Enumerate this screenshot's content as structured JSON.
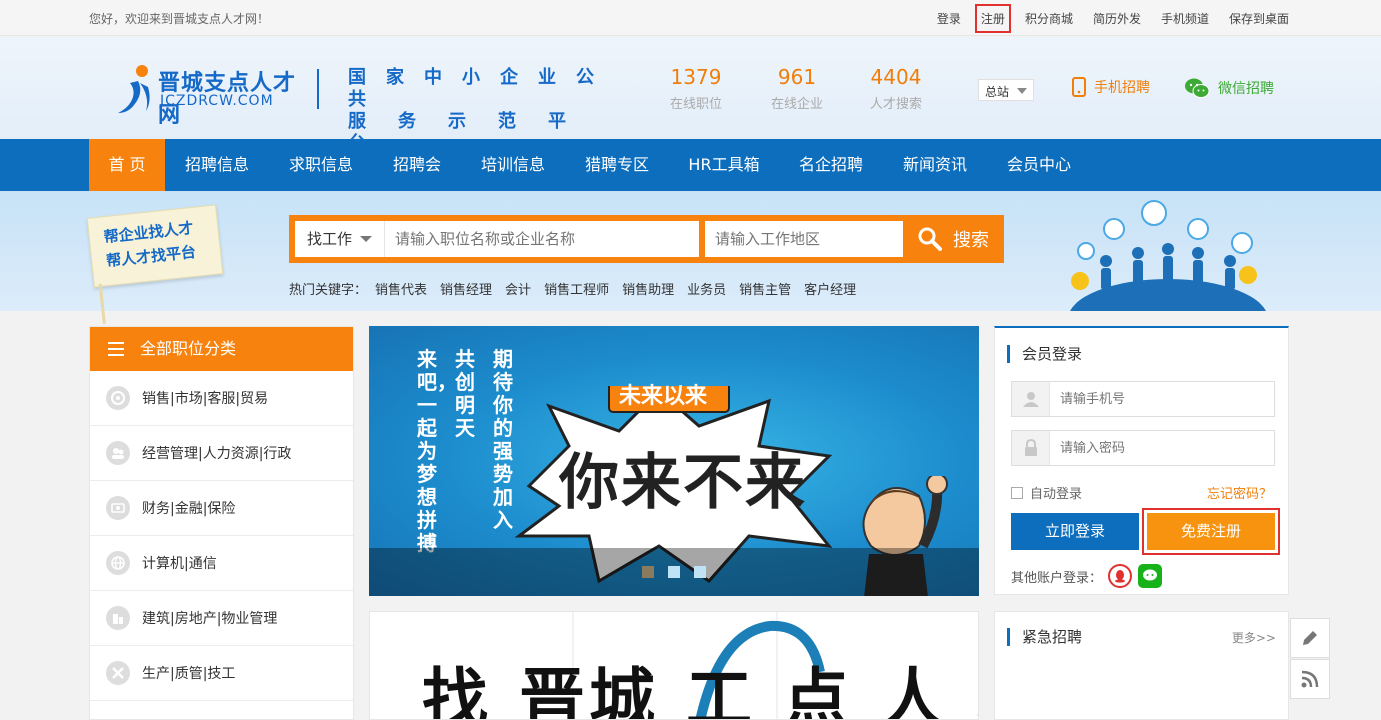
{
  "topbar": {
    "welcome": "您好，欢迎来到晋城支点人才网！",
    "links": [
      "登录",
      "注册",
      "积分商城",
      "简历外发",
      "手机频道",
      "保存到桌面"
    ]
  },
  "header": {
    "logo_name": "晋城支点人才网",
    "logo_domain": "JCZDRCW.COM",
    "slogan_line1": "国家中小企业公共",
    "slogan_line2": "服务示范平台",
    "stats": [
      {
        "num": "1379",
        "label": "在线职位"
      },
      {
        "num": "961",
        "label": "在线企业"
      },
      {
        "num": "4404",
        "label": "人才搜索"
      }
    ],
    "station": "总站",
    "mobile_recruit": "手机招聘",
    "wechat_recruit": "微信招聘",
    "colors": {
      "primary": "#0d6ebd",
      "accent": "#f7820e",
      "wechat": "#3daa35"
    }
  },
  "nav": [
    "首 页",
    "招聘信息",
    "求职信息",
    "招聘会",
    "培训信息",
    "猎聘专区",
    "HR工具箱",
    "名企招聘",
    "新闻资讯",
    "会员中心"
  ],
  "search": {
    "flag_line1": "帮企业找人才",
    "flag_line2": "帮人才找平台",
    "category": "找工作",
    "keyword_placeholder": "请输入职位名称或企业名称",
    "area_placeholder": "请输入工作地区",
    "button": "搜索",
    "hot_label": "热门关键字：",
    "hot": [
      "销售代表",
      "销售经理",
      "会计",
      "销售工程师",
      "销售助理",
      "业务员",
      "销售主管",
      "客户经理"
    ]
  },
  "categories": {
    "title": "全部职位分类",
    "items": [
      "销售|市场|客服|贸易",
      "经营管理|人力资源|行政",
      "财务|金融|保险",
      "计算机|通信",
      "建筑|房地产|物业管理",
      "生产|质管|技工"
    ]
  },
  "slide": {
    "col1": "共创明天",
    "col2": "期待你的强势加入",
    "col3": "来吧，一起为梦想拼搏",
    "tag": "未来以来",
    "headline": "你来不来",
    "active_dot": 1,
    "dots": 3
  },
  "banner2": {
    "text": "找 晋城 工 点 人 才"
  },
  "login": {
    "title": "会员登录",
    "phone_placeholder": "请输手机号",
    "password_placeholder": "请输入密码",
    "auto_login": "自动登录",
    "forgot": "忘记密码？",
    "login_button": "立即登录",
    "register_button": "免费注册",
    "other_login": "其他账户登录："
  },
  "urgent": {
    "title": "紧急招聘",
    "more": "更多>>"
  }
}
